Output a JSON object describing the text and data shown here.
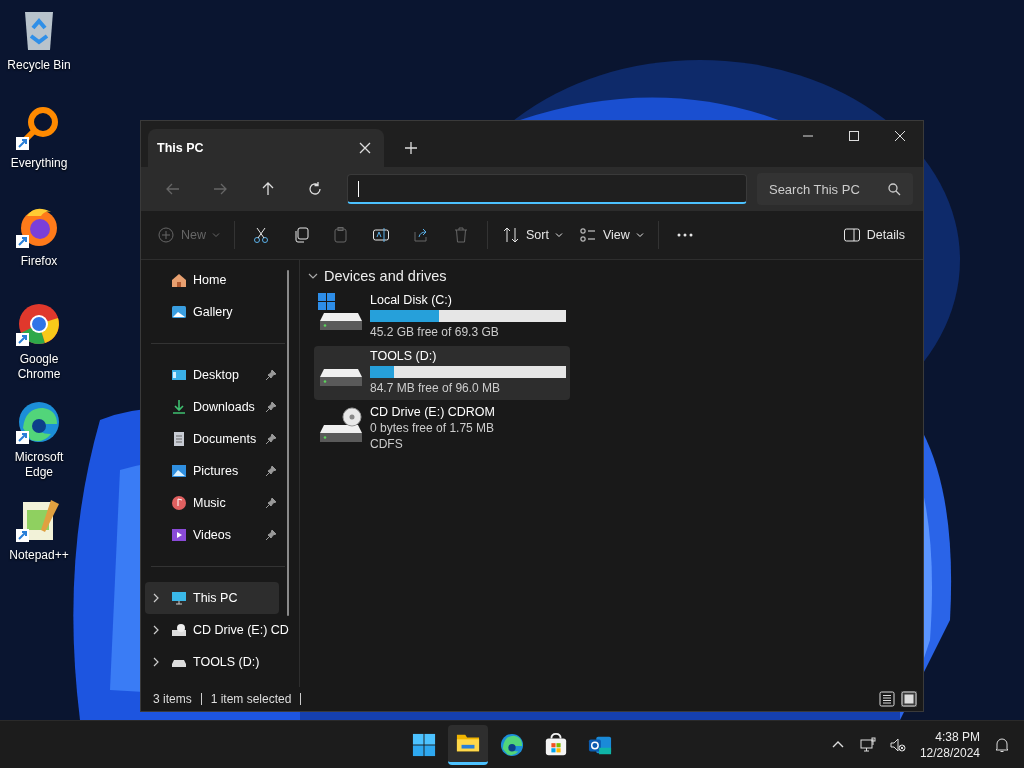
{
  "desktop_icons": [
    {
      "label": "Recycle Bin",
      "kind": "recycle",
      "shortcut": false
    },
    {
      "label": "Everything",
      "kind": "everything",
      "shortcut": true
    },
    {
      "label": "Firefox",
      "kind": "firefox",
      "shortcut": true
    },
    {
      "label": "Google Chrome",
      "kind": "chrome",
      "shortcut": true
    },
    {
      "label": "Microsoft Edge",
      "kind": "edge",
      "shortcut": true
    },
    {
      "label": "Notepad++",
      "kind": "notepad",
      "shortcut": true
    }
  ],
  "window": {
    "tabs": [
      {
        "title": "This PC",
        "selected": true
      }
    ],
    "nav": [
      {
        "kind": "back",
        "disabled": true
      },
      {
        "kind": "forward",
        "disabled": true
      },
      {
        "kind": "up",
        "disabled": false
      },
      {
        "kind": "refresh",
        "disabled": false
      }
    ],
    "address_bar": {
      "focused": true
    },
    "search": {
      "placeholder": "Search This PC"
    },
    "toolbar": {
      "groups": [
        {
          "items": [
            {
              "kind": "new",
              "label": "New",
              "disabled": true,
              "dropdown": true
            }
          ]
        },
        {
          "items": [
            {
              "kind": "cut",
              "disabled": false
            },
            {
              "kind": "copy",
              "disabled": false
            },
            {
              "kind": "paste",
              "disabled": true
            },
            {
              "kind": "rename",
              "disabled": false
            },
            {
              "kind": "share",
              "disabled": true
            },
            {
              "kind": "delete",
              "disabled": true
            }
          ]
        },
        {
          "items": [
            {
              "kind": "sort",
              "label": "Sort",
              "disabled": false,
              "dropdown": true
            },
            {
              "kind": "view",
              "label": "View",
              "disabled": false,
              "dropdown": true
            }
          ]
        },
        {
          "items": [
            {
              "kind": "more",
              "disabled": false
            }
          ]
        }
      ],
      "details_button": {
        "label": "Details"
      }
    },
    "sidebar": {
      "groups": [
        {
          "items": [
            {
              "label": "Home",
              "kind": "home",
              "pinned": false,
              "selected": false,
              "expandable": false
            },
            {
              "label": "Gallery",
              "kind": "gallery",
              "pinned": false,
              "selected": false,
              "expandable": false
            }
          ]
        },
        {
          "items": [
            {
              "label": "Desktop",
              "kind": "desktop",
              "pinned": true,
              "selected": false,
              "expandable": false
            },
            {
              "label": "Downloads",
              "kind": "downloads",
              "pinned": true,
              "selected": false,
              "expandable": false
            },
            {
              "label": "Documents",
              "kind": "documents",
              "pinned": true,
              "selected": false,
              "expandable": false
            },
            {
              "label": "Pictures",
              "kind": "pictures",
              "pinned": true,
              "selected": false,
              "expandable": false
            },
            {
              "label": "Music",
              "kind": "music",
              "pinned": true,
              "selected": false,
              "expandable": false
            },
            {
              "label": "Videos",
              "kind": "videos",
              "pinned": true,
              "selected": false,
              "expandable": false
            }
          ]
        },
        {
          "items": [
            {
              "label": "This PC",
              "kind": "pc",
              "pinned": false,
              "selected": true,
              "expandable": true
            },
            {
              "label": "CD Drive (E:) CD",
              "kind": "cdrom",
              "pinned": false,
              "selected": false,
              "expandable": true
            },
            {
              "label": "TOOLS (D:)",
              "kind": "drive",
              "pinned": false,
              "selected": false,
              "expandable": true
            }
          ]
        }
      ]
    },
    "content": {
      "section": {
        "title": "Devices and drives",
        "expanded": true
      },
      "drives": [
        {
          "name": "Local Disk (C:)",
          "kind": "disk",
          "system": true,
          "level": 0.35,
          "details": [
            "45.2 GB free of 69.3 GB"
          ],
          "selected": false
        },
        {
          "name": "TOOLS (D:)",
          "kind": "disk",
          "system": false,
          "level": 0.12,
          "details": [
            "84.7 MB free of 96.0 MB"
          ],
          "selected": true
        },
        {
          "name": "CD Drive (E:) CDROM",
          "kind": "cdrom",
          "system": false,
          "details": [
            "0 bytes free of 1.75 MB",
            "CDFS"
          ],
          "selected": false
        }
      ]
    },
    "status_bar": {
      "texts": [
        "3 items",
        "1 item selected"
      ],
      "views": [
        {
          "kind": "details",
          "selected": false
        },
        {
          "kind": "tiles",
          "selected": true
        }
      ]
    }
  },
  "taskbar": {
    "apps": [
      {
        "kind": "start",
        "active": false
      },
      {
        "kind": "explorer",
        "active": true
      },
      {
        "kind": "edge",
        "active": false
      },
      {
        "kind": "store",
        "active": false
      },
      {
        "kind": "outlook",
        "active": false
      }
    ],
    "tray": {
      "time": "4:38 PM",
      "date": "12/28/2024"
    }
  }
}
